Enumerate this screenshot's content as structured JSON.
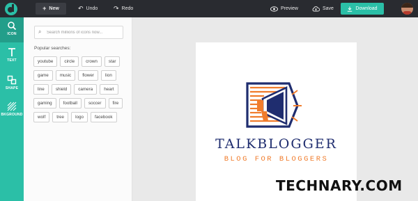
{
  "toolbar": {
    "new_label": "New",
    "undo_label": "Undo",
    "redo_label": "Redo",
    "preview_label": "Preview",
    "save_label": "Save",
    "download_label": "Download"
  },
  "rail": {
    "items": [
      {
        "label": "ICON",
        "icon": "search-icon"
      },
      {
        "label": "TEXT",
        "icon": "text-icon"
      },
      {
        "label": "SHAPE",
        "icon": "shape-icon"
      },
      {
        "label": "BKGROUND",
        "icon": "background-icon"
      }
    ]
  },
  "panel": {
    "search_placeholder": "Search millions of icons now...",
    "popular_title": "Popular searches:",
    "tags": [
      "youtube",
      "circle",
      "crown",
      "star",
      "game",
      "music",
      "flower",
      "lion",
      "line",
      "shield",
      "camera",
      "heart",
      "gaming",
      "football",
      "soccer",
      "fire",
      "wolf",
      "tree",
      "logo",
      "facebook"
    ]
  },
  "canvas": {
    "title": "TALKBLOGGER",
    "subtitle": "BLOG FOR BLOGGERS"
  },
  "watermark": "TECHNARY.COM",
  "colors": {
    "topbar": "#292b30",
    "accent": "#2bbfa7",
    "brand_navy": "#1f2d6f",
    "brand_orange": "#f07c2c"
  }
}
